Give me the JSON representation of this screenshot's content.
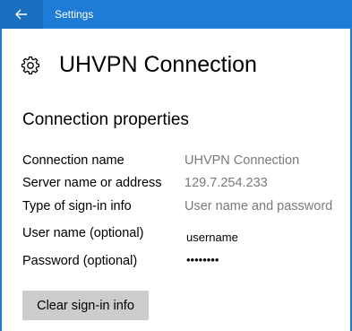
{
  "window": {
    "app_title": "Settings",
    "accent_color": "#1f7cd6"
  },
  "header": {
    "page_title": "UHVPN Connection",
    "icon": "gear-icon"
  },
  "section": {
    "title": "Connection properties"
  },
  "properties": [
    {
      "label": "Connection name",
      "value": "UHVPN Connection"
    },
    {
      "label": "Server name or address",
      "value": "129.7.254.233"
    },
    {
      "label": "Type of sign-in info",
      "value": "User name and password"
    }
  ],
  "credentials": {
    "username_label": "User name (optional)",
    "username_value": "username",
    "password_label": "Password (optional)",
    "password_value": "••••••••"
  },
  "actions": {
    "clear_label": "Clear sign-in info"
  }
}
